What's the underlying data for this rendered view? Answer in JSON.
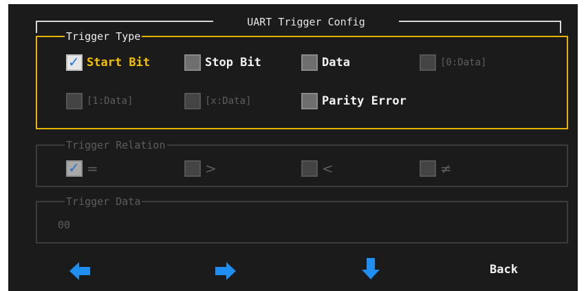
{
  "title": "UART Trigger Config",
  "trigger_type": {
    "label": "Trigger Type",
    "options": [
      {
        "label": "Start Bit",
        "checked": true
      },
      {
        "label": "Stop Bit",
        "checked": false
      },
      {
        "label": "Data",
        "checked": false
      },
      {
        "label": "[0:Data]",
        "checked": false
      },
      {
        "label": "[1:Data]",
        "checked": false
      },
      {
        "label": "[x:Data]",
        "checked": false
      },
      {
        "label": "Parity Error",
        "checked": false
      }
    ]
  },
  "trigger_relation": {
    "label": "Trigger Relation",
    "options": [
      {
        "label": "=",
        "checked": true
      },
      {
        "label": ">",
        "checked": false
      },
      {
        "label": "<",
        "checked": false
      },
      {
        "label": "≠",
        "checked": false
      }
    ]
  },
  "trigger_data": {
    "label": "Trigger Data",
    "value": "00"
  },
  "nav": {
    "left_icon": "arrow-left-icon",
    "right_icon": "arrow-right-icon",
    "down_icon": "arrow-down-icon",
    "back_label": "Back"
  },
  "colors": {
    "accent": "#e8b400",
    "selected_text": "#f5c000",
    "arrow": "#1e8ff0",
    "background": "#1b1b1b"
  }
}
